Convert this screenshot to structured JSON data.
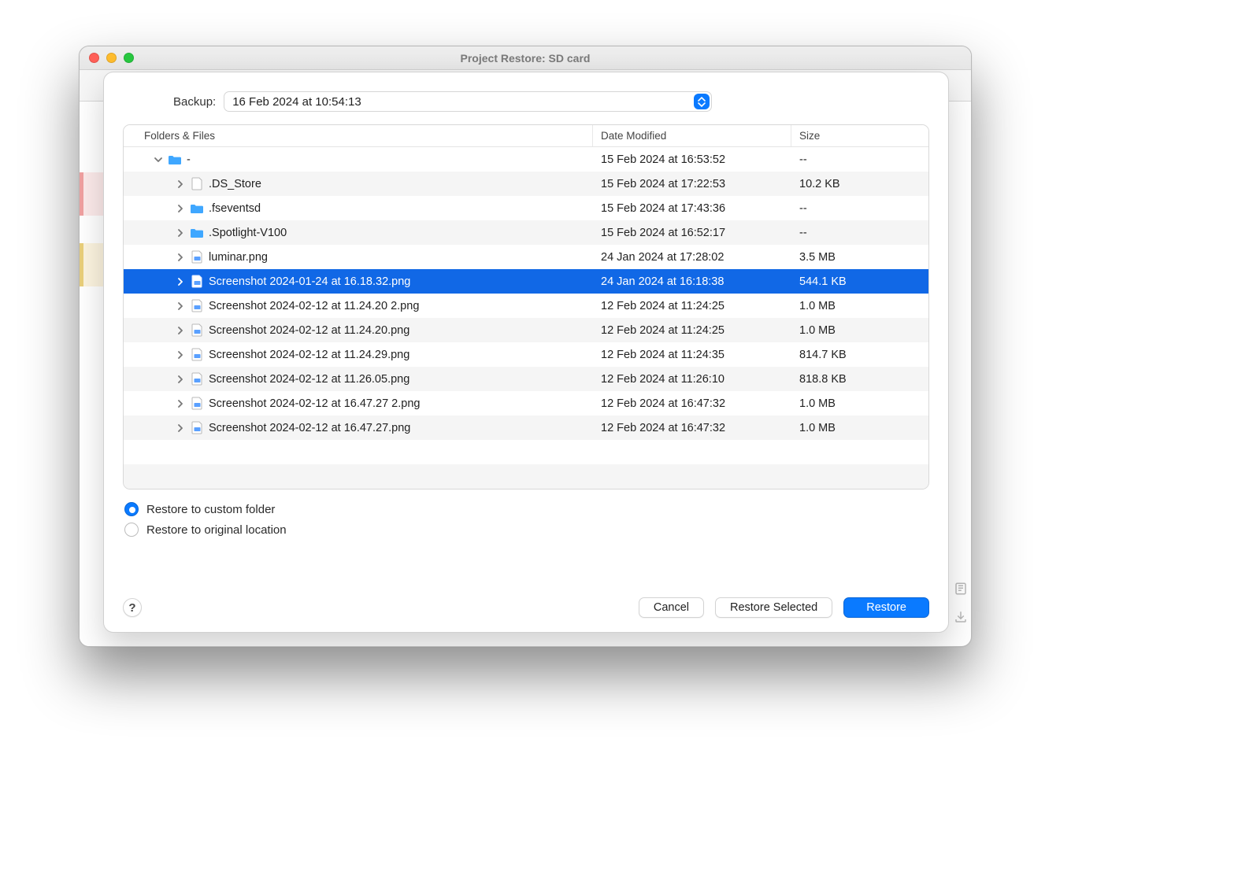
{
  "window": {
    "title": "Project Restore: SD card"
  },
  "backup": {
    "label": "Backup:",
    "selected": "16 Feb 2024 at 10:54:13"
  },
  "columns": {
    "name": "Folders & Files",
    "date": "Date Modified",
    "size": "Size"
  },
  "rows": [
    {
      "indent": 0,
      "expanded": true,
      "type": "folder",
      "name": "-",
      "date": "15 Feb 2024 at 16:53:52",
      "size": "--",
      "selected": false
    },
    {
      "indent": 1,
      "expanded": false,
      "type": "file",
      "name": ".DS_Store",
      "date": "15 Feb 2024 at 17:22:53",
      "size": "10.2 KB",
      "selected": false
    },
    {
      "indent": 1,
      "expanded": false,
      "type": "folder",
      "name": ".fseventsd",
      "date": "15 Feb 2024 at 17:43:36",
      "size": "--",
      "selected": false
    },
    {
      "indent": 1,
      "expanded": false,
      "type": "folder",
      "name": ".Spotlight-V100",
      "date": "15 Feb 2024 at 16:52:17",
      "size": "--",
      "selected": false
    },
    {
      "indent": 1,
      "expanded": false,
      "type": "image",
      "name": "luminar.png",
      "date": "24 Jan 2024 at 17:28:02",
      "size": "3.5 MB",
      "selected": false
    },
    {
      "indent": 1,
      "expanded": false,
      "type": "image",
      "name": "Screenshot 2024-01-24 at 16.18.32.png",
      "date": "24 Jan 2024 at 16:18:38",
      "size": "544.1 KB",
      "selected": true
    },
    {
      "indent": 1,
      "expanded": false,
      "type": "image",
      "name": "Screenshot 2024-02-12 at 11.24.20 2.png",
      "date": "12 Feb 2024 at 11:24:25",
      "size": "1.0 MB",
      "selected": false
    },
    {
      "indent": 1,
      "expanded": false,
      "type": "image",
      "name": "Screenshot 2024-02-12 at 11.24.20.png",
      "date": "12 Feb 2024 at 11:24:25",
      "size": "1.0 MB",
      "selected": false
    },
    {
      "indent": 1,
      "expanded": false,
      "type": "image",
      "name": "Screenshot 2024-02-12 at 11.24.29.png",
      "date": "12 Feb 2024 at 11:24:35",
      "size": "814.7 KB",
      "selected": false
    },
    {
      "indent": 1,
      "expanded": false,
      "type": "image",
      "name": "Screenshot 2024-02-12 at 11.26.05.png",
      "date": "12 Feb 2024 at 11:26:10",
      "size": "818.8 KB",
      "selected": false
    },
    {
      "indent": 1,
      "expanded": false,
      "type": "image",
      "name": "Screenshot 2024-02-12 at 16.47.27 2.png",
      "date": "12 Feb 2024 at 16:47:32",
      "size": "1.0 MB",
      "selected": false
    },
    {
      "indent": 1,
      "expanded": false,
      "type": "image",
      "name": "Screenshot 2024-02-12 at 16.47.27.png",
      "date": "12 Feb 2024 at 16:47:32",
      "size": "1.0 MB",
      "selected": false
    }
  ],
  "radios": {
    "custom": {
      "label": "Restore to custom folder",
      "checked": true
    },
    "original": {
      "label": "Restore to original location",
      "checked": false
    }
  },
  "buttons": {
    "help": "?",
    "cancel": "Cancel",
    "restore_selected": "Restore Selected",
    "restore": "Restore"
  }
}
